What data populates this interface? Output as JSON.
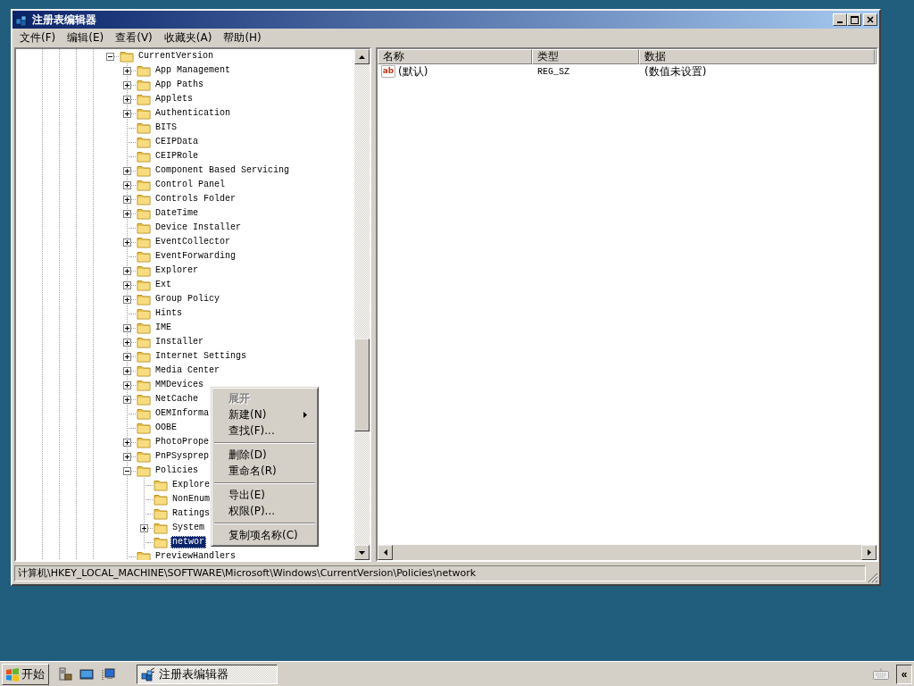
{
  "window": {
    "title": "注册表编辑器"
  },
  "menu_bar": [
    "文件(F)",
    "编辑(E)",
    "查看(V)",
    "收藏夹(A)",
    "帮助(H)"
  ],
  "tree": {
    "items": [
      {
        "label": "CurrentVersion",
        "expandable": true,
        "expanded": true,
        "selected": false,
        "children": [
          {
            "label": "App Management",
            "expandable": true,
            "expanded": false,
            "selected": false
          },
          {
            "label": "App Paths",
            "expandable": true,
            "expanded": false,
            "selected": false
          },
          {
            "label": "Applets",
            "expandable": true,
            "expanded": false,
            "selected": false
          },
          {
            "label": "Authentication",
            "expandable": true,
            "expanded": false,
            "selected": false
          },
          {
            "label": "BITS",
            "expandable": false,
            "selected": false
          },
          {
            "label": "CEIPData",
            "expandable": false,
            "selected": false
          },
          {
            "label": "CEIPRole",
            "expandable": false,
            "selected": false
          },
          {
            "label": "Component Based Servicing",
            "expandable": true,
            "expanded": false,
            "selected": false
          },
          {
            "label": "Control Panel",
            "expandable": true,
            "expanded": false,
            "selected": false
          },
          {
            "label": "Controls Folder",
            "expandable": true,
            "expanded": false,
            "selected": false
          },
          {
            "label": "DateTime",
            "expandable": true,
            "expanded": false,
            "selected": false
          },
          {
            "label": "Device Installer",
            "expandable": false,
            "selected": false
          },
          {
            "label": "EventCollector",
            "expandable": true,
            "expanded": false,
            "selected": false
          },
          {
            "label": "EventForwarding",
            "expandable": false,
            "selected": false
          },
          {
            "label": "Explorer",
            "expandable": true,
            "expanded": false,
            "selected": false
          },
          {
            "label": "Ext",
            "expandable": true,
            "expanded": false,
            "selected": false
          },
          {
            "label": "Group Policy",
            "expandable": true,
            "expanded": false,
            "selected": false
          },
          {
            "label": "Hints",
            "expandable": false,
            "selected": false
          },
          {
            "label": "IME",
            "expandable": true,
            "expanded": false,
            "selected": false
          },
          {
            "label": "Installer",
            "expandable": true,
            "expanded": false,
            "selected": false
          },
          {
            "label": "Internet Settings",
            "expandable": true,
            "expanded": false,
            "selected": false
          },
          {
            "label": "Media Center",
            "expandable": true,
            "expanded": false,
            "selected": false
          },
          {
            "label": "MMDevices",
            "expandable": true,
            "expanded": false,
            "selected": false
          },
          {
            "label": "NetCache",
            "expandable": true,
            "expanded": false,
            "selected": false
          },
          {
            "label": "OEMInforma",
            "expandable": false,
            "selected": false
          },
          {
            "label": "OOBE",
            "expandable": false,
            "selected": false
          },
          {
            "label": "PhotoPrope",
            "expandable": true,
            "expanded": false,
            "selected": false
          },
          {
            "label": "PnPSysprep",
            "expandable": true,
            "expanded": false,
            "selected": false
          },
          {
            "label": "Policies",
            "expandable": true,
            "expanded": true,
            "selected": false,
            "children": [
              {
                "label": "Explore",
                "expandable": false,
                "selected": false
              },
              {
                "label": "NonEnum",
                "expandable": false,
                "selected": false
              },
              {
                "label": "Ratings",
                "expandable": false,
                "selected": false
              },
              {
                "label": "System",
                "expandable": true,
                "expanded": false,
                "selected": false
              },
              {
                "label": "networ",
                "expandable": false,
                "selected": true
              }
            ]
          },
          {
            "label": "PreviewHandlers",
            "expandable": false,
            "selected": false
          }
        ]
      }
    ]
  },
  "list": {
    "columns": [
      "名称",
      "类型",
      "数据"
    ],
    "rows": [
      {
        "icon_text": "ab",
        "name": "(默认)",
        "type": "REG_SZ",
        "data": "(数值未设置)",
        "selected": false
      }
    ]
  },
  "context_menu": {
    "items": [
      {
        "kind": "item",
        "label": "展开",
        "default": true,
        "disabled": true,
        "submenu": false
      },
      {
        "kind": "item",
        "label": "新建(N)",
        "default": false,
        "disabled": false,
        "submenu": true
      },
      {
        "kind": "item",
        "label": "查找(F)...",
        "default": false,
        "disabled": false,
        "submenu": false
      },
      {
        "kind": "separator"
      },
      {
        "kind": "item",
        "label": "删除(D)",
        "default": false,
        "disabled": false,
        "submenu": false
      },
      {
        "kind": "item",
        "label": "重命名(R)",
        "default": false,
        "disabled": false,
        "submenu": false
      },
      {
        "kind": "separator"
      },
      {
        "kind": "item",
        "label": "导出(E)",
        "default": false,
        "disabled": false,
        "submenu": false
      },
      {
        "kind": "item",
        "label": "权限(P)...",
        "default": false,
        "disabled": false,
        "submenu": false
      },
      {
        "kind": "separator"
      },
      {
        "kind": "item",
        "label": "复制项名称(C)",
        "default": false,
        "disabled": false,
        "submenu": false
      }
    ]
  },
  "status_bar": {
    "path": "计算机\\HKEY_LOCAL_MACHINE\\SOFTWARE\\Microsoft\\Windows\\CurrentVersion\\Policies\\network"
  },
  "taskbar": {
    "start_label": "开始",
    "tasks": [
      {
        "label": "注册表编辑器",
        "selected": true
      }
    ],
    "tray_button": "«"
  }
}
